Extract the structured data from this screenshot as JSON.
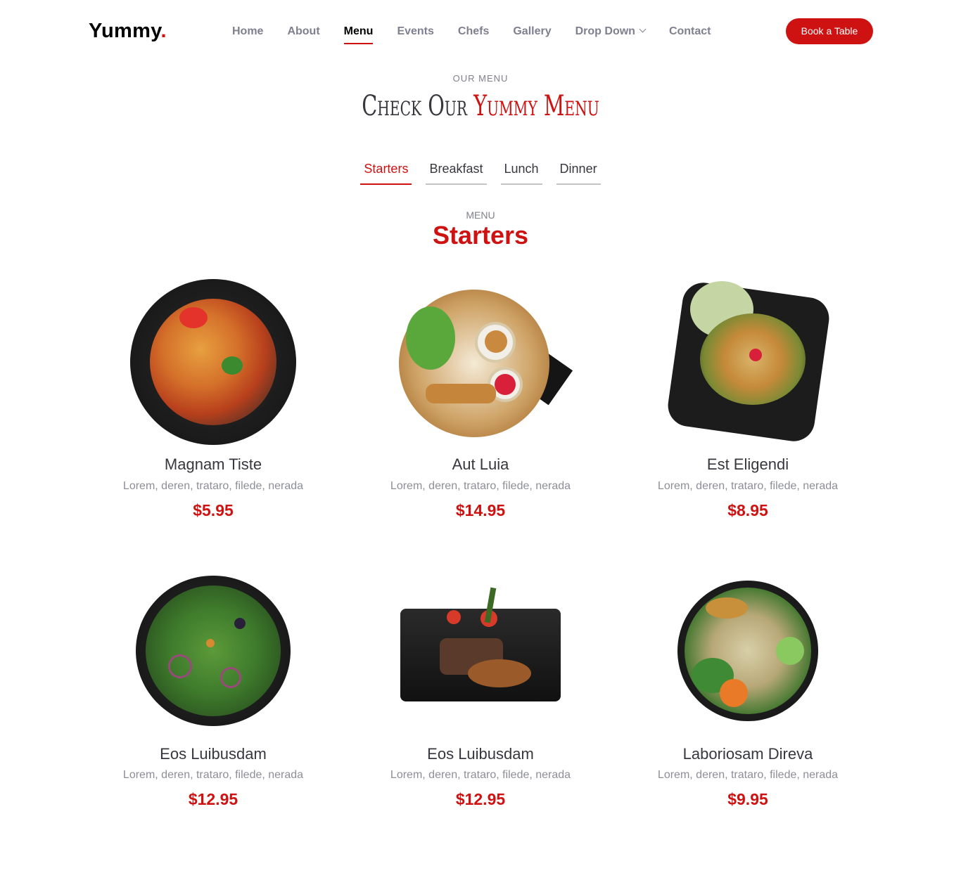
{
  "header": {
    "logo_text": "Yummy",
    "logo_dot": ".",
    "nav": [
      {
        "label": "Home",
        "active": false
      },
      {
        "label": "About",
        "active": false
      },
      {
        "label": "Menu",
        "active": true
      },
      {
        "label": "Events",
        "active": false
      },
      {
        "label": "Chefs",
        "active": false
      },
      {
        "label": "Gallery",
        "active": false
      },
      {
        "label": "Drop Down",
        "active": false
      },
      {
        "label": "Contact",
        "active": false
      }
    ],
    "cta_label": "Book a Table"
  },
  "section": {
    "subtitle": "OUR MENU",
    "title_plain": "Check Our ",
    "title_accent": "Yummy Menu"
  },
  "tabs": [
    {
      "label": "Starters",
      "active": true
    },
    {
      "label": "Breakfast",
      "active": false
    },
    {
      "label": "Lunch",
      "active": false
    },
    {
      "label": "Dinner",
      "active": false
    }
  ],
  "menu": {
    "subtitle": "MENU",
    "title": "Starters",
    "items": [
      {
        "name": "Magnam Tiste",
        "ingredients": "Lorem, deren, trataro, filede, nerada",
        "price": "$5.95"
      },
      {
        "name": "Aut Luia",
        "ingredients": "Lorem, deren, trataro, filede, nerada",
        "price": "$14.95"
      },
      {
        "name": "Est Eligendi",
        "ingredients": "Lorem, deren, trataro, filede, nerada",
        "price": "$8.95"
      },
      {
        "name": "Eos Luibusdam",
        "ingredients": "Lorem, deren, trataro, filede, nerada",
        "price": "$12.95"
      },
      {
        "name": "Eos Luibusdam",
        "ingredients": "Lorem, deren, trataro, filede, nerada",
        "price": "$12.95"
      },
      {
        "name": "Laboriosam Direva",
        "ingredients": "Lorem, deren, trataro, filede, nerada",
        "price": "$9.95"
      }
    ]
  },
  "colors": {
    "accent": "#ce1212",
    "nav_text": "#7f7f90",
    "heading": "#37373f"
  }
}
